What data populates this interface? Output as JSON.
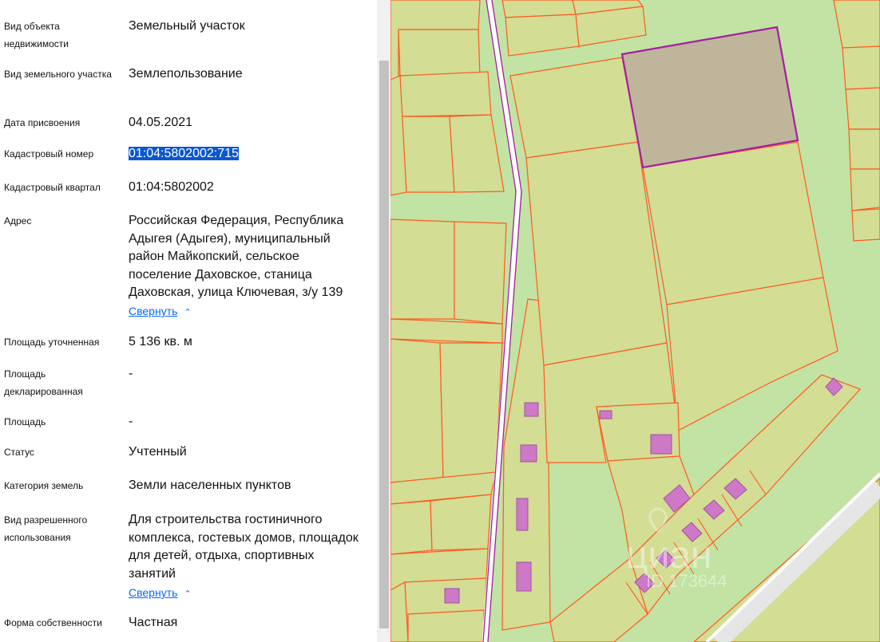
{
  "properties": [
    {
      "label": "Вид объекта недвижимости",
      "value": "Земельный участок"
    },
    {
      "label": "Вид земельного участка",
      "value": "Землепользование"
    },
    {
      "label": "Дата присвоения",
      "value": "04.05.2021"
    },
    {
      "label": "Кадастровый номер",
      "value": "01:04:5802002:715"
    },
    {
      "label": "Кадастровый квартал",
      "value": "01:04:5802002"
    },
    {
      "label": "Адрес",
      "value": "Российская Федерация, Республика Адыгея (Адыгея), муниципальный район Майкопский, сельское поселение Даховское, станица Даховская, улица Ключевая, з/у 139"
    },
    {
      "label": "Площадь уточненная",
      "value": "5 136 кв. м"
    },
    {
      "label": "Площадь декларированная",
      "value": "-"
    },
    {
      "label": "Площадь",
      "value": "-"
    },
    {
      "label": "Статус",
      "value": "Учтенный"
    },
    {
      "label": "Категория земель",
      "value": "Земли населенных пунктов"
    },
    {
      "label": "Вид разрешенного использования",
      "value": "Для строительства гостиничного комплекса, гостевых домов, площадок для детей, отдыха, спортивных занятий"
    },
    {
      "label": "Форма собственности",
      "value": "Частная"
    }
  ],
  "collapse_label": "Свернуть",
  "watermark": {
    "brand": "циан",
    "id": "ID 173644"
  },
  "icons": {
    "collapse": "chevron-up-icon",
    "watermark": "location-pin-icon"
  },
  "colors": {
    "selection": "#0b57d0",
    "link": "#0468ff",
    "parcel_fill": "#d3dd94",
    "parcel_border": "#ff5a1f",
    "background_green": "#c2e3a3",
    "selected_parcel": "#beb59a",
    "selected_border": "#a51ea1",
    "building": "#cd79c8",
    "road": "#e6e6e6"
  }
}
